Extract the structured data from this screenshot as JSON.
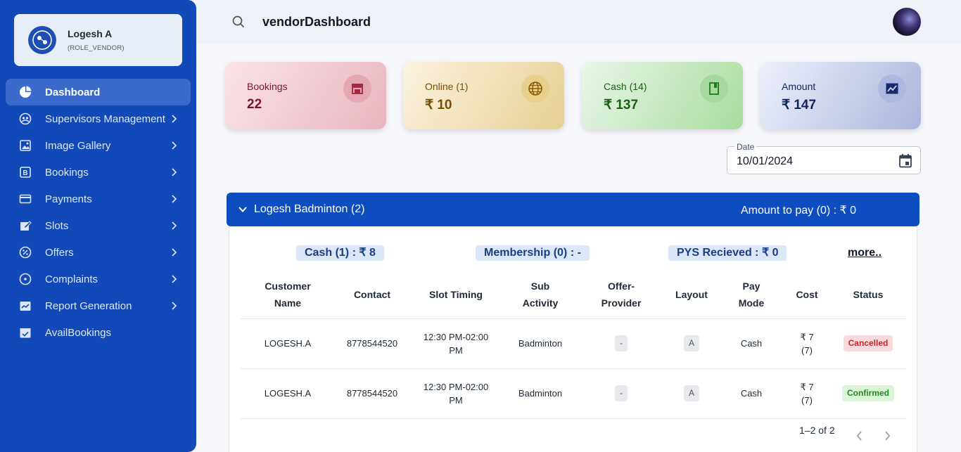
{
  "user": {
    "name": "Logesh A",
    "role": "(ROLE_VENDOR)"
  },
  "sidebar": {
    "items": [
      {
        "label": "Dashboard",
        "icon": "pie-chart-icon",
        "active": true
      },
      {
        "label": "Supervisors Management",
        "icon": "team-icon"
      },
      {
        "label": "Image Gallery",
        "icon": "gallery-icon"
      },
      {
        "label": "Bookings",
        "icon": "bookings-icon"
      },
      {
        "label": "Payments",
        "icon": "card-icon"
      },
      {
        "label": "Slots",
        "icon": "edit-icon"
      },
      {
        "label": "Offers",
        "icon": "offer-icon"
      },
      {
        "label": "Complaints",
        "icon": "complaint-icon"
      },
      {
        "label": "Report Generation",
        "icon": "report-icon"
      },
      {
        "label": "AvailBookings",
        "icon": "calendar-check-icon"
      }
    ]
  },
  "header": {
    "title": "vendorDashboard"
  },
  "stats": [
    {
      "label": "Bookings",
      "value": "22",
      "icon": "store-icon"
    },
    {
      "label": "Online (1)",
      "value": "₹ 10",
      "icon": "globe-icon"
    },
    {
      "label": "Cash (14)",
      "value": "₹ 137",
      "icon": "book-icon"
    },
    {
      "label": "Amount",
      "value": "₹ 147",
      "icon": "trend-chart-icon"
    }
  ],
  "date": {
    "label": "Date",
    "value": "10/01/2024"
  },
  "group": {
    "title": "Logesh Badminton (2)",
    "amount_to_pay": "Amount to pay (0) : ₹ 0",
    "pills": {
      "cash": "Cash (1) : ₹ 8",
      "membership": "Membership (0) : -",
      "pys": "PYS Recieved : ₹ 0"
    },
    "more": "more.."
  },
  "table": {
    "headers": {
      "customer_1": "Customer",
      "customer_2": "Name",
      "contact": "Contact",
      "slot": "Slot Timing",
      "sub_1": "Sub",
      "sub_2": "Activity",
      "offer_1": "Offer-",
      "offer_2": "Provider",
      "layout": "Layout",
      "pay_1": "Pay",
      "pay_2": "Mode",
      "cost": "Cost",
      "status": "Status"
    },
    "rows": [
      {
        "name": "LOGESH.A",
        "contact": "8778544520",
        "slot_1": "12:30 PM-02:00",
        "slot_2": "PM",
        "sub": "Badminton",
        "offer": "-",
        "layout": "A",
        "pay": "Cash",
        "cost_1": "₹ 7",
        "cost_2": "(7)",
        "status": "Cancelled"
      },
      {
        "name": "LOGESH.A",
        "contact": "8778544520",
        "slot_1": "12:30 PM-02:00",
        "slot_2": "PM",
        "sub": "Badminton",
        "offer": "-",
        "layout": "A",
        "pay": "Cash",
        "cost_1": "₹ 7",
        "cost_2": "(7)",
        "status": "Confirmed"
      }
    ],
    "pagination": "1–2 of 2"
  },
  "colors": {
    "sidebar": "#1149b8",
    "primary": "#0d4dbf",
    "cancelled": "#c0282d",
    "confirmed": "#1d8a1d"
  }
}
